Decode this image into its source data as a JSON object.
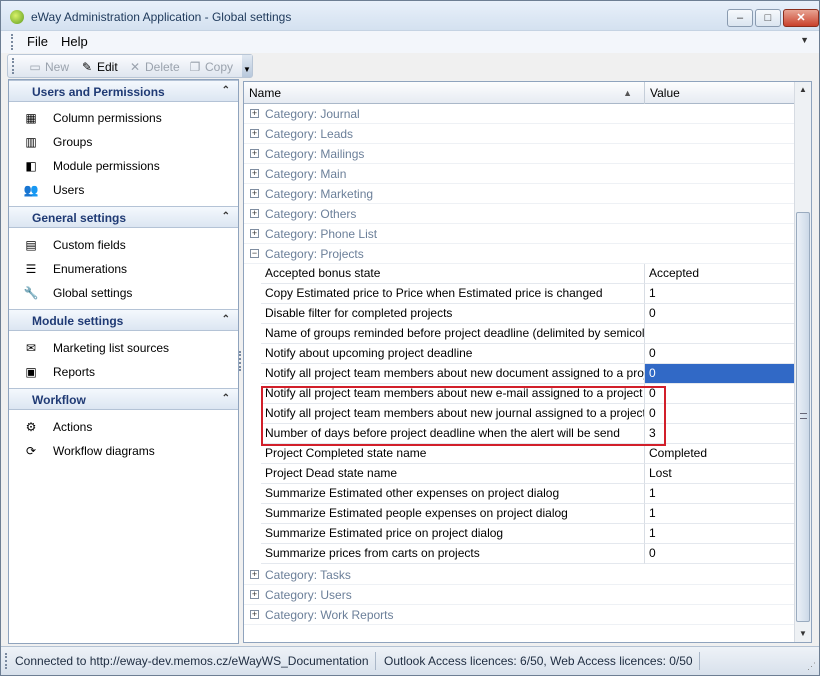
{
  "window": {
    "title": "eWay Administration Application - Global settings",
    "controls": {
      "minimize": "–",
      "maximize": "□",
      "close": "✕"
    }
  },
  "menu": {
    "items": [
      {
        "label": "File"
      },
      {
        "label": "Help"
      }
    ]
  },
  "toolbar": {
    "new_label": "New",
    "edit_label": "Edit",
    "delete_label": "Delete",
    "copy_label": "Copy"
  },
  "sidebar": {
    "groups": [
      {
        "title": "Users and Permissions",
        "items": [
          {
            "label": "Column permissions",
            "icon": "column-permissions-icon"
          },
          {
            "label": "Groups",
            "icon": "groups-icon"
          },
          {
            "label": "Module permissions",
            "icon": "module-permissions-icon"
          },
          {
            "label": "Users",
            "icon": "users-icon"
          }
        ]
      },
      {
        "title": "General settings",
        "items": [
          {
            "label": "Custom fields",
            "icon": "custom-fields-icon"
          },
          {
            "label": "Enumerations",
            "icon": "enumerations-icon"
          },
          {
            "label": "Global settings",
            "icon": "global-settings-icon"
          }
        ]
      },
      {
        "title": "Module settings",
        "items": [
          {
            "label": "Marketing list sources",
            "icon": "marketing-list-sources-icon"
          },
          {
            "label": "Reports",
            "icon": "reports-icon"
          }
        ]
      },
      {
        "title": "Workflow",
        "items": [
          {
            "label": "Actions",
            "icon": "actions-icon"
          },
          {
            "label": "Workflow diagrams",
            "icon": "workflow-diagrams-icon"
          }
        ]
      }
    ]
  },
  "grid": {
    "columns": {
      "name": "Name",
      "value": "Value"
    },
    "categories_before": [
      "Category: Journal",
      "Category: Leads",
      "Category: Mailings",
      "Category: Main",
      "Category: Marketing",
      "Category: Others",
      "Category: Phone List"
    ],
    "expanded_category": "Category: Projects",
    "rows": [
      {
        "name": "Accepted bonus state",
        "value": "Accepted"
      },
      {
        "name": "Copy Estimated price to Price when Estimated price is changed",
        "value": "1"
      },
      {
        "name": "Disable filter for completed projects",
        "value": "0"
      },
      {
        "name": "Name of groups reminded before project deadline (delimited by semicolon)",
        "value": ""
      },
      {
        "name": "Notify about upcoming project deadline",
        "value": "0"
      },
      {
        "name": "Notify all project team members about new document assigned to a project",
        "value": "0"
      },
      {
        "name": "Notify all project team members about new e-mail assigned to a project",
        "value": "0"
      },
      {
        "name": "Notify all project team members about new journal assigned to a project",
        "value": "0"
      },
      {
        "name": "Number of days before project deadline when the alert will be send",
        "value": "3"
      },
      {
        "name": "Project Completed state name",
        "value": "Completed"
      },
      {
        "name": "Project Dead state name",
        "value": "Lost"
      },
      {
        "name": "Summarize Estimated other expenses on project dialog",
        "value": "1"
      },
      {
        "name": "Summarize Estimated people expenses on project dialog",
        "value": "1"
      },
      {
        "name": "Summarize Estimated price on project dialog",
        "value": "1"
      },
      {
        "name": "Summarize prices from carts on projects",
        "value": "0"
      }
    ],
    "categories_after": [
      "Category: Tasks",
      "Category: Users",
      "Category: Work Reports"
    ]
  },
  "status": {
    "connection": "Connected to http://eway-dev.memos.cz/eWayWS_Documentation",
    "licences": "Outlook Access licences: 6/50, Web Access licences: 0/50"
  }
}
